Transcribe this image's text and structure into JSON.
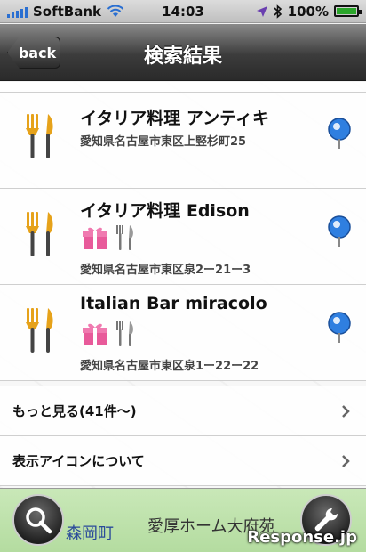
{
  "status": {
    "carrier": "SoftBank",
    "time": "14:03",
    "battery": "100%"
  },
  "nav": {
    "back_label": "back",
    "title": "検索結果"
  },
  "results": [
    {
      "name": "イタリア料理 アンティキ",
      "address": "愛知県名古屋市東区上竪杉町25",
      "badges": []
    },
    {
      "name": "イタリア料理 Edison",
      "address": "愛知県名古屋市東区泉2ー21ー3",
      "badges": [
        "gift-icon",
        "fork-knife-icon"
      ]
    },
    {
      "name": "Italian Bar miracolo",
      "address": "愛知県名古屋市東区泉1ー22ー22",
      "badges": [
        "gift-icon",
        "fork-knife-icon"
      ]
    }
  ],
  "more": {
    "label": "もっと見る(41件〜)"
  },
  "about_icons": {
    "label": "表示アイコンについて"
  },
  "map": {
    "label1": "森岡町",
    "label2": "愛厚ホーム大府苑"
  },
  "watermark": "Response.jp",
  "colors": {
    "accent_blue": "#2a6fd1",
    "battery_green": "#2aa52a",
    "pin_blue": "#2f7fe0",
    "cutlery_gold": "#e6a21a"
  }
}
